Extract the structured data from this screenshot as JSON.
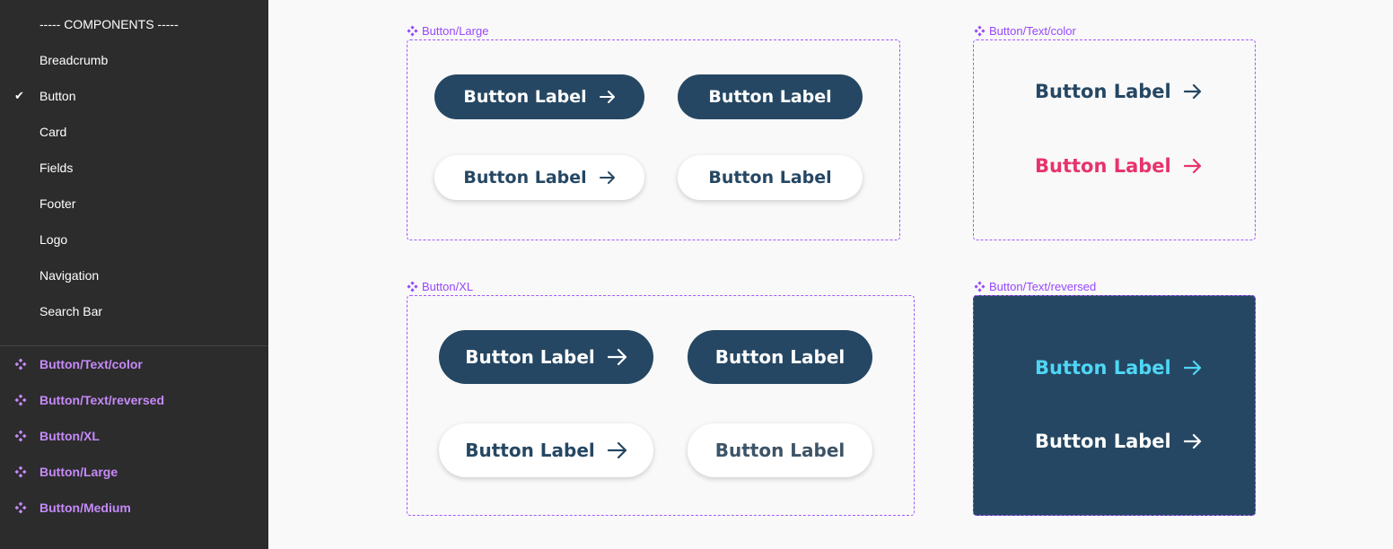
{
  "sidebar": {
    "section_header": "----- COMPONENTS -----",
    "pages": [
      {
        "label": "Breadcrumb",
        "checked": false
      },
      {
        "label": "Button",
        "checked": true
      },
      {
        "label": "Card",
        "checked": false
      },
      {
        "label": "Fields",
        "checked": false
      },
      {
        "label": "Footer",
        "checked": false
      },
      {
        "label": "Logo",
        "checked": false
      },
      {
        "label": "Navigation",
        "checked": false
      },
      {
        "label": "Search Bar",
        "checked": false
      }
    ],
    "components": [
      {
        "label": "Button/Text/color"
      },
      {
        "label": "Button/Text/reversed"
      },
      {
        "label": "Button/XL"
      },
      {
        "label": "Button/Large"
      },
      {
        "label": "Button/Medium"
      }
    ],
    "check_glyph": "✔"
  },
  "canvas": {
    "frames": {
      "large": {
        "label": "Button/Large"
      },
      "text_color": {
        "label": "Button/Text/color"
      },
      "xl": {
        "label": "Button/XL"
      },
      "text_reversed": {
        "label": "Button/Text/reversed"
      }
    },
    "button_label": "Button Label"
  },
  "colors": {
    "navy": "#254763",
    "pink": "#e7336c",
    "cyan": "#4fd6f5",
    "purple": "#c58af9",
    "frame_border": "#a259ff"
  },
  "icons": {
    "component": "component-icon",
    "arrow": "arrow-right-icon",
    "check": "check-icon"
  }
}
